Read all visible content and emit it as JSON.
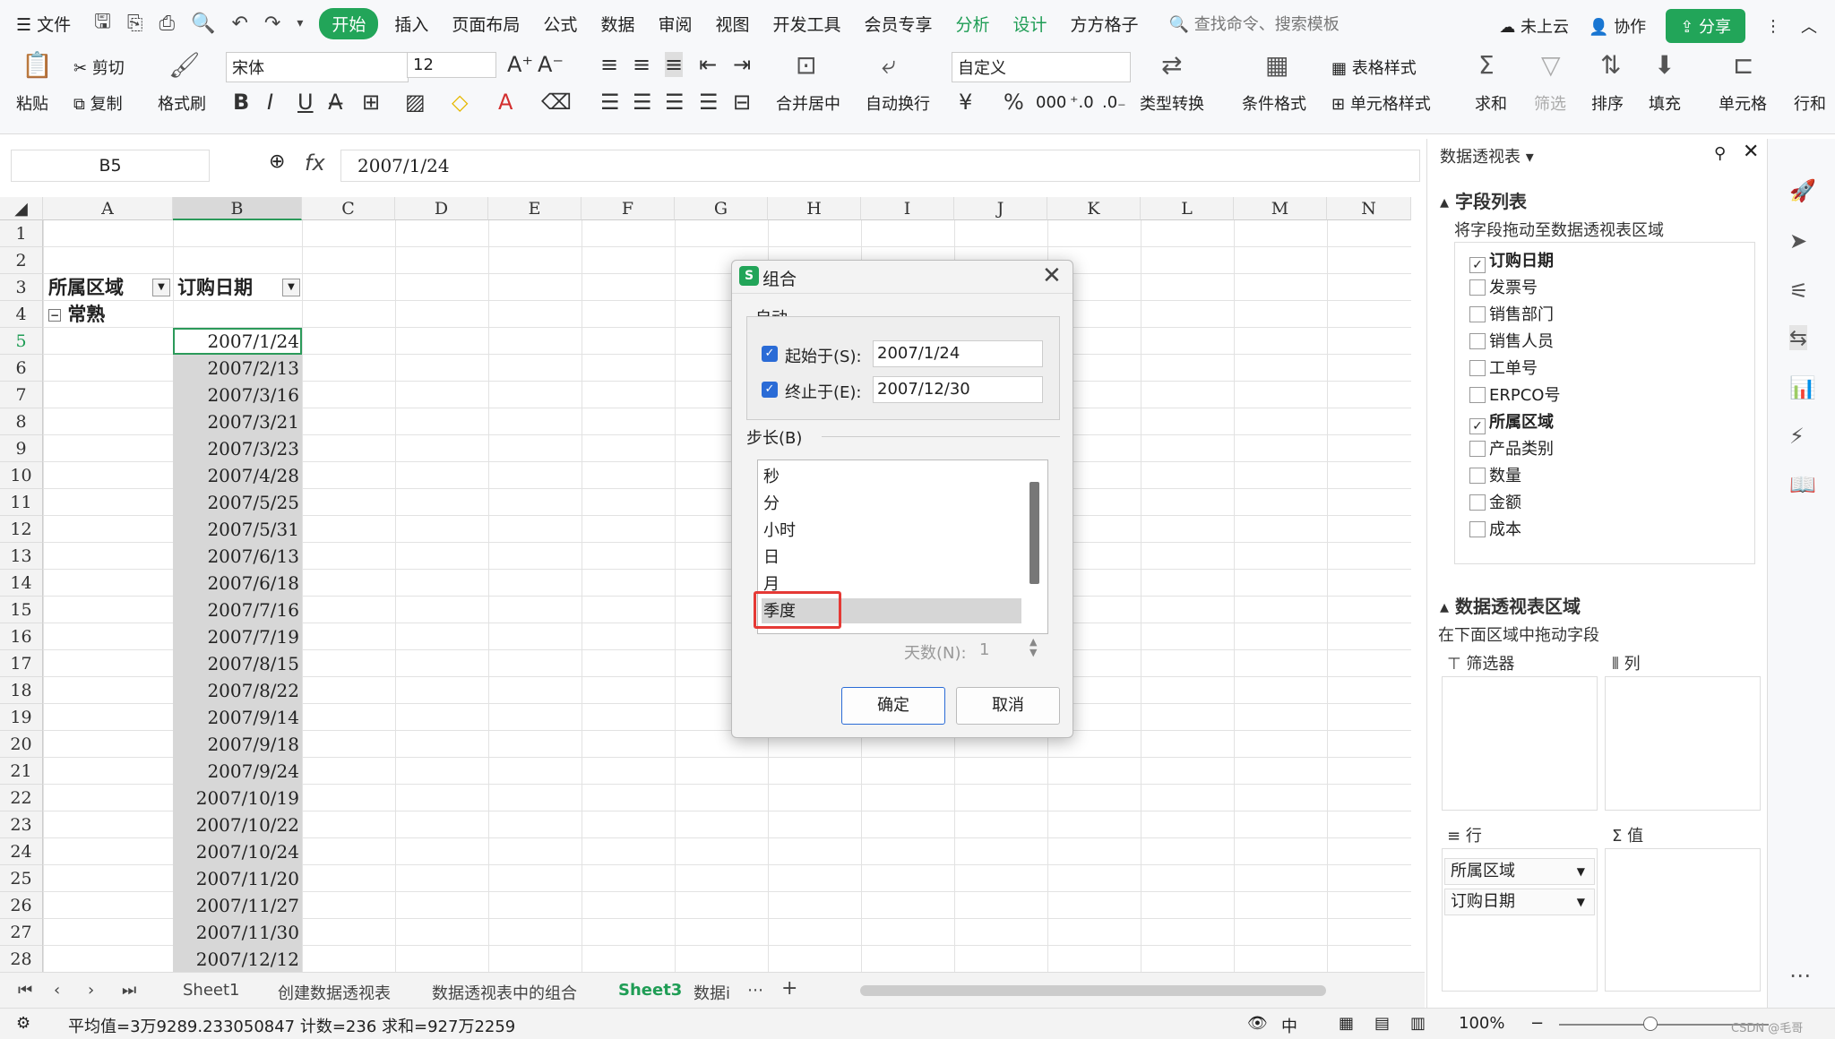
{
  "menubar": {
    "file": "文件",
    "tabs": [
      "开始",
      "插入",
      "页面布局",
      "公式",
      "数据",
      "审阅",
      "视图",
      "开发工具",
      "会员专享",
      "分析",
      "设计",
      "方方格子"
    ],
    "search": "查找命令、搜索模板",
    "cloud": "未上云",
    "collab": "协作",
    "share": "分享"
  },
  "ribbon": {
    "paste": "粘贴",
    "cut": "剪切",
    "copy": "复制",
    "format_painter": "格式刷",
    "font_name": "宋体",
    "font_size": "12",
    "merge_center": "合并居中",
    "wrap": "自动换行",
    "num_format": "自定义",
    "type_convert": "类型转换",
    "cond_format": "条件格式",
    "table_style": "表格样式",
    "cell_style": "单元格样式",
    "sum": "求和",
    "filter": "筛选",
    "sort": "排序",
    "fill": "填充",
    "cell": "单元格",
    "row_col": "行和"
  },
  "formula": {
    "cell_ref": "B5",
    "fx": "fx",
    "value": "2007/1/24"
  },
  "sheet": {
    "columns": [
      "A",
      "B",
      "C",
      "D",
      "E",
      "F",
      "G",
      "H",
      "I",
      "J",
      "K",
      "L",
      "M",
      "N"
    ],
    "rows": [
      "1",
      "2",
      "3",
      "4",
      "5",
      "6",
      "7",
      "8",
      "9",
      "10",
      "11",
      "12",
      "13",
      "14",
      "15",
      "16",
      "17",
      "18",
      "19",
      "20",
      "21",
      "22",
      "23",
      "24",
      "25",
      "26",
      "27",
      "28"
    ],
    "header_a": "所属区域",
    "header_b": "订购日期",
    "group_label": "常熟",
    "dates": [
      "2007/1/24",
      "2007/2/13",
      "2007/3/16",
      "2007/3/21",
      "2007/3/23",
      "2007/4/28",
      "2007/5/25",
      "2007/5/31",
      "2007/6/13",
      "2007/6/18",
      "2007/7/16",
      "2007/7/19",
      "2007/8/15",
      "2007/8/22",
      "2007/9/14",
      "2007/9/18",
      "2007/9/24",
      "2007/10/19",
      "2007/10/22",
      "2007/10/24",
      "2007/11/20",
      "2007/11/27",
      "2007/11/30",
      "2007/12/12"
    ]
  },
  "sheet_tabs": [
    "Sheet1",
    "创建数据透视表",
    "数据透视表中的组合",
    "Sheet3",
    "数据i"
  ],
  "status": {
    "stats": "平均值=3万9289.233050847  计数=236  求和=927万2259",
    "zoom": "100%",
    "watermark": "CSDN @毛哥"
  },
  "panel": {
    "title": "数据透视表",
    "field_list_title": "字段列表",
    "field_list_hint": "将字段拖动至数据透视表区域",
    "fields": [
      {
        "label": "订购日期",
        "checked": true
      },
      {
        "label": "发票号",
        "checked": false
      },
      {
        "label": "销售部门",
        "checked": false
      },
      {
        "label": "销售人员",
        "checked": false
      },
      {
        "label": "工单号",
        "checked": false
      },
      {
        "label": "ERPCO号",
        "checked": false
      },
      {
        "label": "所属区域",
        "checked": true
      },
      {
        "label": "产品类别",
        "checked": false
      },
      {
        "label": "数量",
        "checked": false
      },
      {
        "label": "金额",
        "checked": false
      },
      {
        "label": "成本",
        "checked": false
      }
    ],
    "area_title": "数据透视表区域",
    "area_hint": "在下面区域中拖动字段",
    "filter_label": "筛选器",
    "col_label": "列",
    "row_label": "行",
    "value_label": "值",
    "row_fields": [
      "所属区域",
      "订购日期"
    ]
  },
  "dialog": {
    "title": "组合",
    "auto_label": "自动",
    "start_label": "起始于(S):",
    "start_value": "2007/1/24",
    "end_label": "终止于(E):",
    "end_value": "2007/12/30",
    "step_label": "步长(B)",
    "step_items": [
      "秒",
      "分",
      "小时",
      "日",
      "月",
      "季度"
    ],
    "selected_item": "季度",
    "days_label": "天数(N):",
    "days_value": "1",
    "ok": "确定",
    "cancel": "取消"
  }
}
